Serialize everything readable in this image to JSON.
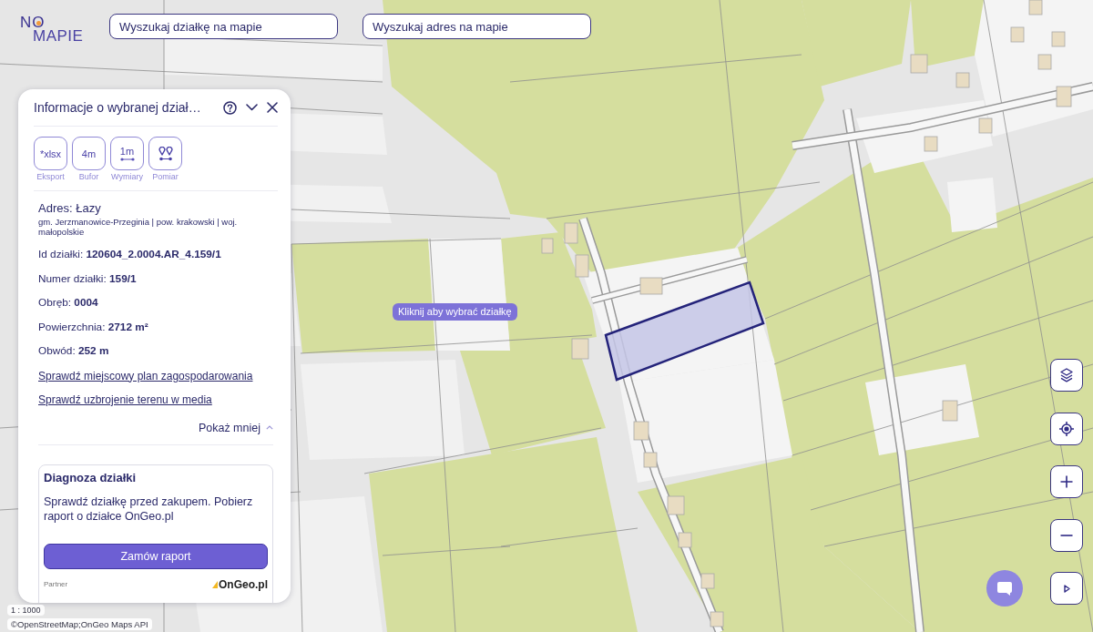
{
  "logo": {
    "line_1": "NO",
    "line_2": "MAPIE"
  },
  "search_fields": [
    {
      "placeholder": "Wyszukaj działkę na mapie"
    },
    {
      "placeholder": "Wyszukaj adres na mapie"
    }
  ],
  "map": {
    "tooltip": "Kliknij aby wybrać działkę",
    "scale": "1 : 1000",
    "attribution": "©OpenStreetMap;OnGeo Maps API"
  },
  "panel": {
    "title": "Informacje o wybranej dział…",
    "tools": [
      {
        "kind": "text",
        "label": "*xlsx",
        "caption": "Eksport"
      },
      {
        "kind": "text",
        "label": "4m",
        "caption": "Bufor"
      },
      {
        "kind": "dimension",
        "label": "1m",
        "caption": "Wymiary"
      },
      {
        "kind": "measure",
        "caption": "Pomiar"
      }
    ],
    "address": {
      "title": "Adres: Łazy",
      "details": "gm. Jerzmanowice-Przeginia | pow. krakowski | woj. małopolskie"
    },
    "fields": [
      "Id działki: **120604_2.0004.AR_4.159/1**",
      "Numer działki: **159/1**",
      "Obręb: **0004**",
      "Powierzchnia: **2712 m²**",
      "Obwód: **252 m**"
    ],
    "links": [
      "Sprawdź miejscowy plan zagospodarowania",
      "Sprawdź uzbrojenie terenu w media"
    ],
    "toggle": {
      "label": "Pokaż mniej",
      "expanded": true
    },
    "card": {
      "title": "Diagnoza działki",
      "text": "Sprawdź działkę przed zakupem. Pobierz raport o działce OnGeo.pl",
      "button": "Zamów raport",
      "partner_label": "Partner",
      "partner_name": "OnGeo.pl"
    }
  },
  "map_controls": [
    {
      "kind": "layers"
    },
    {
      "kind": "locate"
    },
    {
      "kind": "zoom_in"
    },
    {
      "kind": "zoom_out"
    },
    {
      "kind": "expand"
    }
  ]
}
